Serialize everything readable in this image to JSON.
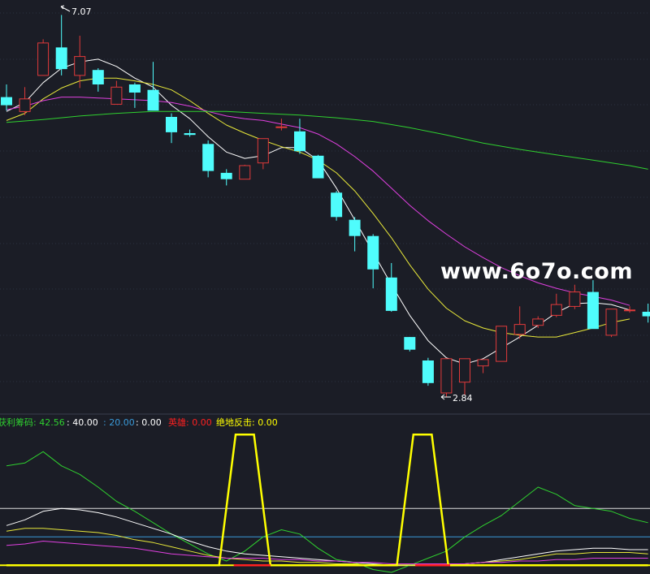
{
  "colors": {
    "background": "#1b1d26",
    "grid": "#2b3140",
    "up_candle": "#e03a3a",
    "down_candle": "#4ffcfc",
    "ma_fast": "#ffffff",
    "ma_mid": "#e8e83a",
    "ma_slow": "#e040e0",
    "ma_long": "#2fd12f",
    "watermark": "#ffffff",
    "ind_green": "#2fd12f",
    "ind_white": "#ffffff",
    "ind_yellow": "#e8e83a",
    "ind_magenta": "#e040e0",
    "ind_level_white": "#dddddd",
    "ind_level_blue": "#3a9ad9",
    "ind_signal": "#ffff00",
    "ind_red": "#ff2020"
  },
  "watermark": "www.6o7o.com",
  "main": {
    "high_label": "7.07",
    "low_label": "2.84"
  },
  "indicator": {
    "label_1": "获利筹码: 42.56",
    "label_2": ": 40.00",
    "label_3": ": 20.00",
    "label_4": ": 0.00",
    "label_5": "英雄: 0.00",
    "label_6": "绝地反击: 0.00"
  },
  "chart_data": [
    {
      "type": "candlestick",
      "yscale": "price",
      "ylim": [
        2.7,
        7.2
      ],
      "candles": [
        {
          "o": 6.16,
          "h": 6.3,
          "l": 6.01,
          "c": 6.07
        },
        {
          "o": 6.0,
          "h": 6.27,
          "l": 5.96,
          "c": 6.14
        },
        {
          "o": 6.4,
          "h": 6.8,
          "l": 6.4,
          "c": 6.76
        },
        {
          "o": 6.71,
          "h": 7.07,
          "l": 6.4,
          "c": 6.47
        },
        {
          "o": 6.4,
          "h": 6.84,
          "l": 6.26,
          "c": 6.61
        },
        {
          "o": 6.46,
          "h": 6.48,
          "l": 6.22,
          "c": 6.3
        },
        {
          "o": 6.08,
          "h": 6.34,
          "l": 6.08,
          "c": 6.27
        },
        {
          "o": 6.3,
          "h": 6.32,
          "l": 6.04,
          "c": 6.21
        },
        {
          "o": 6.24,
          "h": 6.55,
          "l": 6.03,
          "c": 6.01
        },
        {
          "o": 5.94,
          "h": 5.98,
          "l": 5.65,
          "c": 5.77
        },
        {
          "o": 5.76,
          "h": 5.8,
          "l": 5.72,
          "c": 5.74
        },
        {
          "o": 5.64,
          "h": 5.68,
          "l": 5.27,
          "c": 5.34
        },
        {
          "o": 5.32,
          "h": 5.36,
          "l": 5.18,
          "c": 5.25
        },
        {
          "o": 5.25,
          "h": 5.41,
          "l": 5.25,
          "c": 5.4
        },
        {
          "o": 5.43,
          "h": 5.7,
          "l": 5.36,
          "c": 5.7
        },
        {
          "o": 5.83,
          "h": 5.92,
          "l": 5.79,
          "c": 5.83
        },
        {
          "o": 5.78,
          "h": 5.92,
          "l": 5.53,
          "c": 5.56
        },
        {
          "o": 5.51,
          "h": 5.52,
          "l": 5.27,
          "c": 5.26
        },
        {
          "o": 5.1,
          "h": 5.12,
          "l": 4.79,
          "c": 4.83
        },
        {
          "o": 4.8,
          "h": 4.83,
          "l": 4.45,
          "c": 4.62
        },
        {
          "o": 4.62,
          "h": 4.64,
          "l": 4.04,
          "c": 4.25
        },
        {
          "o": 4.16,
          "h": 4.32,
          "l": 3.78,
          "c": 3.79
        },
        {
          "o": 3.5,
          "h": 3.5,
          "l": 3.34,
          "c": 3.36
        },
        {
          "o": 3.24,
          "h": 3.27,
          "l": 2.96,
          "c": 2.99
        },
        {
          "o": 2.88,
          "h": 3.23,
          "l": 2.84,
          "c": 3.26
        },
        {
          "o": 3.0,
          "h": 3.26,
          "l": 2.86,
          "c": 3.26
        },
        {
          "o": 3.18,
          "h": 3.24,
          "l": 3.1,
          "c": 3.25
        },
        {
          "o": 3.23,
          "h": 3.62,
          "l": 3.23,
          "c": 3.62
        },
        {
          "o": 3.53,
          "h": 3.84,
          "l": 3.48,
          "c": 3.64
        },
        {
          "o": 3.63,
          "h": 3.73,
          "l": 3.6,
          "c": 3.7
        },
        {
          "o": 3.74,
          "h": 3.98,
          "l": 3.72,
          "c": 3.86
        },
        {
          "o": 3.84,
          "h": 4.08,
          "l": 3.81,
          "c": 4.0
        },
        {
          "o": 4.0,
          "h": 4.13,
          "l": 3.6,
          "c": 3.59
        },
        {
          "o": 3.52,
          "h": 3.79,
          "l": 3.5,
          "c": 3.81
        },
        {
          "o": 3.8,
          "h": 3.84,
          "l": 3.77,
          "c": 3.8
        },
        {
          "o": 3.78,
          "h": 3.87,
          "l": 3.66,
          "c": 3.73
        }
      ],
      "ma_series": [
        {
          "color_key": "ma_fast",
          "points": [
            [
              0,
              6.0
            ],
            [
              1,
              6.1
            ],
            [
              2,
              6.32
            ],
            [
              3,
              6.48
            ],
            [
              4,
              6.55
            ],
            [
              5,
              6.58
            ],
            [
              6,
              6.5
            ],
            [
              7,
              6.37
            ],
            [
              8,
              6.27
            ],
            [
              9,
              6.07
            ],
            [
              10,
              5.92
            ],
            [
              11,
              5.72
            ],
            [
              12,
              5.55
            ],
            [
              13,
              5.48
            ],
            [
              14,
              5.51
            ],
            [
              15,
              5.6
            ],
            [
              16,
              5.6
            ],
            [
              17,
              5.46
            ],
            [
              18,
              5.15
            ],
            [
              19,
              4.8
            ],
            [
              20,
              4.44
            ],
            [
              21,
              4.08
            ],
            [
              22,
              3.74
            ],
            [
              23,
              3.46
            ],
            [
              24,
              3.27
            ],
            [
              25,
              3.2
            ],
            [
              26,
              3.26
            ],
            [
              27,
              3.38
            ],
            [
              28,
              3.5
            ],
            [
              29,
              3.63
            ],
            [
              30,
              3.77
            ],
            [
              31,
              3.87
            ],
            [
              32,
              3.88
            ],
            [
              33,
              3.86
            ],
            [
              34,
              3.8
            ]
          ]
        },
        {
          "color_key": "ma_mid",
          "points": [
            [
              0,
              5.9
            ],
            [
              1,
              5.98
            ],
            [
              2,
              6.14
            ],
            [
              3,
              6.26
            ],
            [
              4,
              6.34
            ],
            [
              5,
              6.37
            ],
            [
              6,
              6.37
            ],
            [
              7,
              6.34
            ],
            [
              8,
              6.3
            ],
            [
              9,
              6.24
            ],
            [
              10,
              6.12
            ],
            [
              11,
              5.98
            ],
            [
              12,
              5.85
            ],
            [
              13,
              5.76
            ],
            [
              14,
              5.68
            ],
            [
              15,
              5.61
            ],
            [
              16,
              5.55
            ],
            [
              17,
              5.46
            ],
            [
              18,
              5.32
            ],
            [
              19,
              5.12
            ],
            [
              20,
              4.87
            ],
            [
              21,
              4.6
            ],
            [
              22,
              4.3
            ],
            [
              23,
              4.03
            ],
            [
              24,
              3.82
            ],
            [
              25,
              3.68
            ],
            [
              26,
              3.6
            ],
            [
              27,
              3.55
            ],
            [
              28,
              3.52
            ],
            [
              29,
              3.5
            ],
            [
              30,
              3.5
            ],
            [
              31,
              3.55
            ],
            [
              32,
              3.6
            ],
            [
              33,
              3.66
            ],
            [
              34,
              3.7
            ]
          ]
        },
        {
          "color_key": "ma_slow",
          "points": [
            [
              0,
              6.02
            ],
            [
              1,
              6.06
            ],
            [
              2,
              6.12
            ],
            [
              3,
              6.16
            ],
            [
              4,
              6.16
            ],
            [
              5,
              6.15
            ],
            [
              6,
              6.14
            ],
            [
              7,
              6.13
            ],
            [
              8,
              6.12
            ],
            [
              9,
              6.1
            ],
            [
              10,
              6.06
            ],
            [
              11,
              6.0
            ],
            [
              12,
              5.95
            ],
            [
              13,
              5.92
            ],
            [
              14,
              5.9
            ],
            [
              15,
              5.86
            ],
            [
              16,
              5.82
            ],
            [
              17,
              5.75
            ],
            [
              18,
              5.64
            ],
            [
              19,
              5.5
            ],
            [
              20,
              5.34
            ],
            [
              21,
              5.15
            ],
            [
              22,
              4.96
            ],
            [
              23,
              4.79
            ],
            [
              24,
              4.64
            ],
            [
              25,
              4.5
            ],
            [
              26,
              4.38
            ],
            [
              27,
              4.27
            ],
            [
              28,
              4.18
            ],
            [
              29,
              4.1
            ],
            [
              30,
              4.04
            ],
            [
              31,
              3.99
            ],
            [
              32,
              3.95
            ],
            [
              33,
              3.91
            ],
            [
              34,
              3.85
            ]
          ]
        },
        {
          "color_key": "ma_long",
          "points": [
            [
              0,
              5.88
            ],
            [
              2,
              5.91
            ],
            [
              4,
              5.95
            ],
            [
              6,
              5.98
            ],
            [
              8,
              6.0
            ],
            [
              10,
              6.0
            ],
            [
              12,
              6.0
            ],
            [
              14,
              5.98
            ],
            [
              16,
              5.96
            ],
            [
              18,
              5.93
            ],
            [
              20,
              5.89
            ],
            [
              22,
              5.82
            ],
            [
              24,
              5.74
            ],
            [
              26,
              5.65
            ],
            [
              28,
              5.58
            ],
            [
              30,
              5.52
            ],
            [
              32,
              5.46
            ],
            [
              34,
              5.4
            ],
            [
              35,
              5.36
            ]
          ]
        }
      ]
    },
    {
      "type": "line",
      "ylim": [
        -5,
        95
      ],
      "x": [
        0,
        1,
        2,
        3,
        4,
        5,
        6,
        7,
        8,
        9,
        10,
        11,
        12,
        13,
        14,
        15,
        16,
        17,
        18,
        19,
        20,
        21,
        22,
        23,
        24,
        25,
        26,
        27,
        28,
        29,
        30,
        31,
        32,
        33,
        34,
        35
      ],
      "series": [
        {
          "color_key": "ind_green",
          "values": [
            70,
            72,
            80,
            70,
            64,
            55,
            45,
            38,
            30,
            22,
            15,
            8,
            3,
            10,
            20,
            25,
            22,
            12,
            4,
            2,
            -3,
            -5,
            0,
            5,
            10,
            20,
            28,
            35,
            45,
            55,
            50,
            42,
            40,
            38,
            33,
            30
          ]
        },
        {
          "color_key": "ind_white",
          "values": [
            28,
            32,
            38,
            40,
            39,
            37,
            34,
            30,
            26,
            22,
            17,
            13,
            10,
            8,
            7,
            6,
            5,
            4,
            3,
            2,
            1,
            0,
            0,
            0,
            0,
            1,
            2,
            4,
            6,
            8,
            10,
            11,
            12,
            12,
            11,
            11
          ]
        },
        {
          "color_key": "ind_yellow",
          "values": [
            24,
            26,
            26,
            25,
            24,
            23,
            21,
            18,
            16,
            13,
            10,
            7,
            5,
            4,
            3,
            3,
            2,
            2,
            1,
            1,
            0,
            0,
            0,
            0,
            0,
            1,
            2,
            3,
            4,
            6,
            8,
            8,
            9,
            9,
            9,
            8
          ]
        },
        {
          "color_key": "ind_magenta",
          "values": [
            14,
            15,
            17,
            16,
            15,
            14,
            13,
            12,
            10,
            8,
            7,
            6,
            5,
            5,
            5,
            4,
            4,
            3,
            3,
            2,
            2,
            1,
            1,
            1,
            1,
            1,
            2,
            2,
            3,
            3,
            4,
            4,
            5,
            5,
            5,
            5
          ]
        }
      ],
      "signal": {
        "color_key": "ind_signal",
        "low": 0,
        "high": 92,
        "x": [
          0,
          11.6,
          12.5,
          13.5,
          14.4,
          21.3,
          22.2,
          23.2,
          24.1,
          35
        ],
        "values": [
          0,
          0,
          92,
          92,
          0,
          0,
          92,
          92,
          0,
          0
        ]
      },
      "red_segments": [
        [
          12.4,
          14.4
        ],
        [
          22.3,
          24.2
        ]
      ],
      "levels": [
        {
          "value": 40,
          "color_key": "ind_level_white"
        },
        {
          "value": 20,
          "color_key": "ind_level_blue"
        },
        {
          "value": 0,
          "color_key": "ind_signal"
        }
      ]
    }
  ]
}
